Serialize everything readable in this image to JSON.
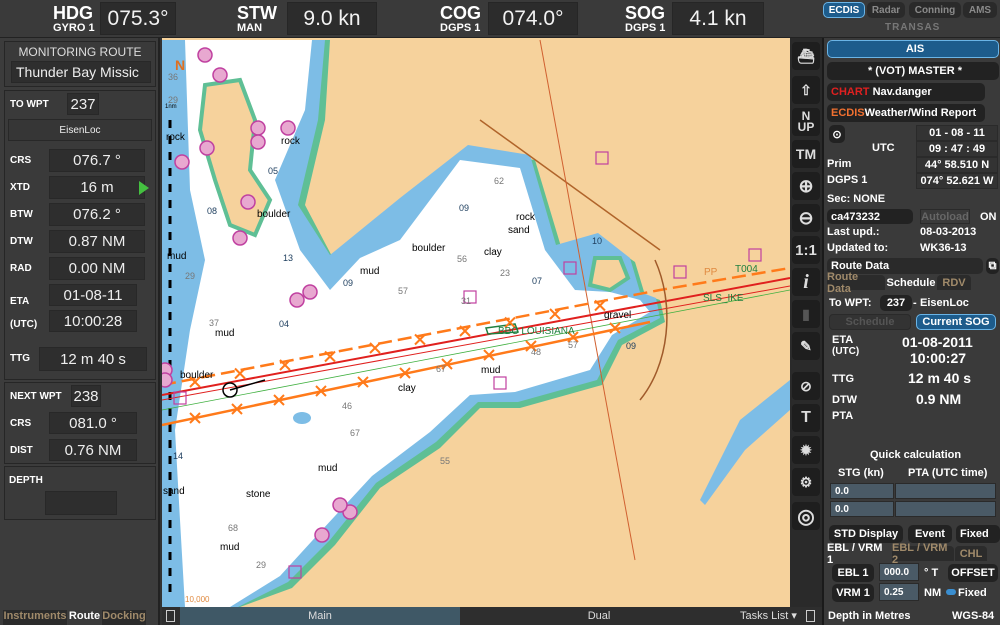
{
  "top": {
    "hdg": {
      "label": "HDG",
      "source": "GYRO 1",
      "value": "075.3°"
    },
    "stw": {
      "label": "STW",
      "source": "MAN",
      "value": "9.0 kn"
    },
    "cog": {
      "label": "COG",
      "source": "DGPS 1",
      "value": "074.0°"
    },
    "sog": {
      "label": "SOG",
      "source": "DGPS 1",
      "value": "4.1 kn"
    },
    "modes": [
      "ECDIS",
      "Radar",
      "Conning",
      "AMS"
    ],
    "active_mode": "ECDIS",
    "brand": "TRANSAS"
  },
  "left": {
    "monitoring_title": "MONITORING ROUTE",
    "route_name": "Thunder Bay Missic",
    "to_wpt_label": "TO WPT",
    "to_wpt": "237",
    "wpt_name": "EisenLoc",
    "rows": [
      {
        "label": "CRS",
        "value": "076.7 °"
      },
      {
        "label": "XTD",
        "value": "16 m"
      },
      {
        "label": "BTW",
        "value": "076.2 °"
      },
      {
        "label": "DTW",
        "value": "0.87 NM"
      },
      {
        "label": "RAD",
        "value": "0.00 NM"
      }
    ],
    "eta_label": "ETA",
    "eta_sub": "(UTC)",
    "eta_date": "01-08-11",
    "eta_time": "10:00:28",
    "ttg_label": "TTG",
    "ttg": "12 m 40 s",
    "next_wpt_label": "NEXT WPT",
    "next_wpt": "238",
    "next_rows": [
      {
        "label": "CRS",
        "value": "081.0 °"
      },
      {
        "label": "DIST",
        "value": "0.76 NM"
      }
    ],
    "depth_label": "DEPTH",
    "depth": "",
    "tabs": [
      "Instruments",
      "Route",
      "Docking"
    ],
    "active_tab": "Route"
  },
  "map": {
    "north_label": "N",
    "scale_label": "1nm",
    "labels": [
      "rock",
      "rock",
      "boulder",
      "mud",
      "mud",
      "boulder",
      "clay",
      "rock",
      "sand",
      "gravel",
      "mud",
      "boulder",
      "clay",
      "mud",
      "mud",
      "stone",
      "mud",
      "sand",
      "BBC LOUISIANA",
      "SLS_IKE",
      "T004",
      "PP"
    ],
    "soundings": [
      "36",
      "29",
      "05",
      "08",
      "13",
      "09",
      "57",
      "62",
      "09",
      "10",
      "29",
      "37",
      "04",
      "56",
      "23",
      "07",
      "31",
      "48",
      "57",
      "09",
      "67",
      "46",
      "67",
      "55",
      "14",
      "68",
      "29",
      "10,000"
    ],
    "colors": {
      "land": "#f6d29c",
      "water": "#ffffff",
      "shallow": "#7dbde6",
      "intertidal": "#5fbf95",
      "route": "#ff7a1a",
      "track": "#e0201e",
      "danger": "#cc44aa"
    }
  },
  "mapbar": {
    "main": "Main",
    "dual": "Dual",
    "tasks": "Tasks List"
  },
  "tools": [
    "ship-centre",
    "ship-up",
    "N UP",
    "TM",
    "zoom-in",
    "zoom-out",
    "1:1",
    "i",
    "chart-layers",
    "route-edit",
    "target-track",
    "T",
    "sun-brightness",
    "settings",
    "lifebuoy"
  ],
  "right": {
    "ais": "AIS",
    "master": "* (VOT) MASTER *",
    "chart_prefix": "CHART",
    "chart_alarm": "Nav.danger",
    "ecdis_prefix": "ECDIS",
    "ecdis_alarm": "Weather/Wind Report",
    "date": "01 - 08 - 11",
    "utc_label": "UTC",
    "time": "09 : 47 : 49",
    "prim_label": "Prim",
    "lat": "44° 58.510 N",
    "dgps_label": "DGPS 1",
    "lon": "074° 52.621 W",
    "sec_label": "Sec: NONE",
    "chart_cell": "ca473232",
    "autoload": "Autoload",
    "autoload_state": "ON",
    "last_upd_label": "Last upd.:",
    "last_upd": "08-03-2013",
    "updated_to_label": "Updated to:",
    "updated_to": "WK36-13",
    "route_data_select": "Route Data",
    "subtabs": [
      "Route Data",
      "Schedule",
      "RDV"
    ],
    "active_subtab": "Schedule",
    "to_wpt_label": "To WPT:",
    "to_wpt": "237",
    "to_wpt_sep": "-",
    "to_wpt_name": "EisenLoc",
    "schedule_btn": "Schedule",
    "current_sog_btn": "Current SOG",
    "eta_label": "ETA",
    "eta_sub": "(UTC)",
    "eta_date": "01-08-2011",
    "eta_time": "10:00:27",
    "ttg_label": "TTG",
    "ttg": "12 m 40 s",
    "dtw_label": "DTW",
    "dtw": "0.9 NM",
    "pta_label": "PTA",
    "pta": "",
    "quick_calc": "Quick calculation",
    "qc_headers": [
      "STG (kn)",
      "PTA (UTC time)"
    ],
    "qc_rows": [
      [
        "0.0",
        ""
      ],
      [
        "0.0",
        ""
      ]
    ],
    "std_display": "STD Display",
    "event": "Event",
    "fixed_select": "Fixed",
    "ebl_tabs": [
      "EBL / VRM 1",
      "EBL / VRM 2",
      "CHL"
    ],
    "active_ebl_tab": "EBL / VRM 1",
    "ebl_btn": "EBL 1",
    "ebl_value": "000.0",
    "ebl_unit": "° T",
    "offset_btn": "OFFSET",
    "vrm_btn": "VRM 1",
    "vrm_value": "0.25",
    "vrm_unit": "NM",
    "fixed_label": "Fixed",
    "depth_units": "Depth in Metres",
    "datum": "WGS-84"
  }
}
